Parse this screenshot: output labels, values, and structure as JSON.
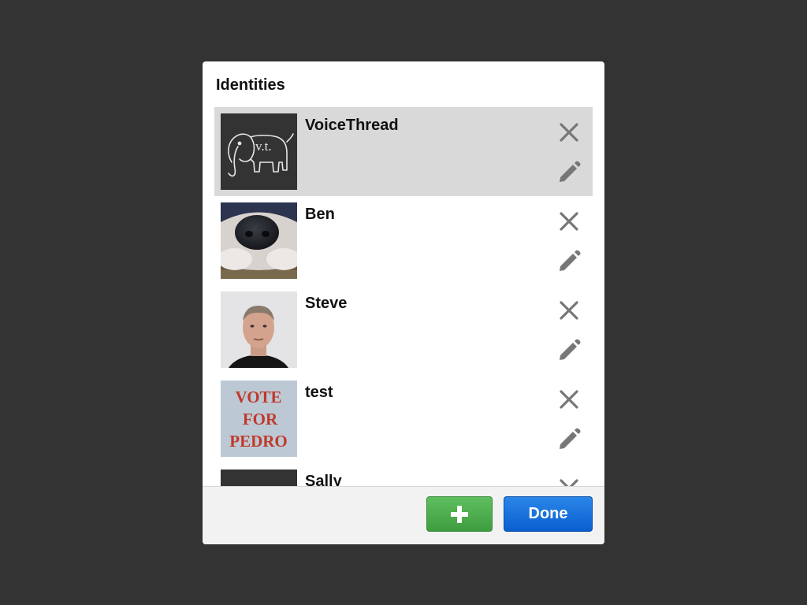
{
  "dialog": {
    "title": "Identities",
    "done_label": "Done",
    "add_icon": "plus-icon"
  },
  "identities": [
    {
      "name": "VoiceThread",
      "selected": true,
      "avatar": "voicethread-elephant-logo",
      "avatar_text": "v.t."
    },
    {
      "name": "Ben",
      "selected": false,
      "avatar": "dog-nose-photo"
    },
    {
      "name": "Steve",
      "selected": false,
      "avatar": "man-portrait-photo"
    },
    {
      "name": "test",
      "selected": false,
      "avatar": "vote-for-pedro-shirt-photo",
      "avatar_text": "VOTE FOR PEDRO"
    },
    {
      "name": "Sally",
      "selected": false,
      "avatar": "dark-avatar"
    }
  ],
  "row_actions": {
    "delete_icon": "close-icon",
    "edit_icon": "pencil-icon"
  },
  "colors": {
    "backdrop": "#333333",
    "selected_row": "#d9d9d9",
    "add_button": "#4cae4c",
    "done_button": "#1a73e0",
    "icon_gray": "#777777"
  }
}
